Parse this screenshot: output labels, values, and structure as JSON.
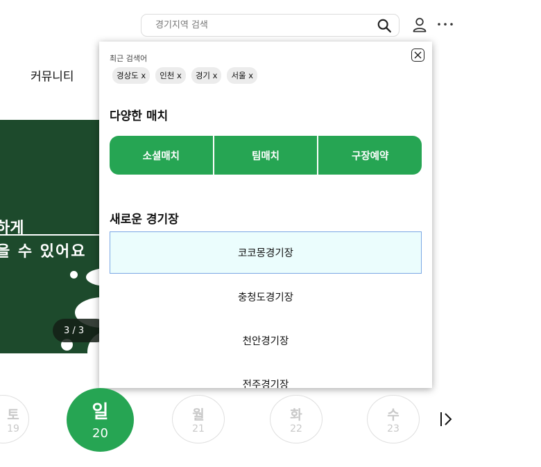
{
  "header": {
    "search_placeholder": "경기지역 검색",
    "icons": [
      "search-icon",
      "user-icon",
      "more-icon"
    ]
  },
  "nav": {
    "community": "커뮤니티"
  },
  "banner": {
    "line1": "하게",
    "line2": "을 수 있어요",
    "pager": "3 / 3"
  },
  "search_panel": {
    "recent_label": "최근 검색어",
    "recent_terms": [
      "경상도 x",
      "인천 x",
      "경기 x",
      "서울 x"
    ],
    "match_title": "다양한 매치",
    "match_buttons": [
      "소셜매치",
      "팀매치",
      "구장예약"
    ],
    "stadium_title": "새로운 경기장",
    "stadiums": [
      "코코몽경기장",
      "충청도경기장",
      "천안경기장",
      "전주경기장"
    ]
  },
  "dates": [
    {
      "name": "토",
      "num": "19"
    },
    {
      "name": "일",
      "num": "20"
    },
    {
      "name": "월",
      "num": "21"
    },
    {
      "name": "화",
      "num": "22"
    },
    {
      "name": "수",
      "num": "23"
    }
  ],
  "colors": {
    "accent": "#26a553",
    "selected_bg": "#ebfdfd",
    "selected_border": "#7aa6e4",
    "banner_bg": "#1d4a2c"
  }
}
